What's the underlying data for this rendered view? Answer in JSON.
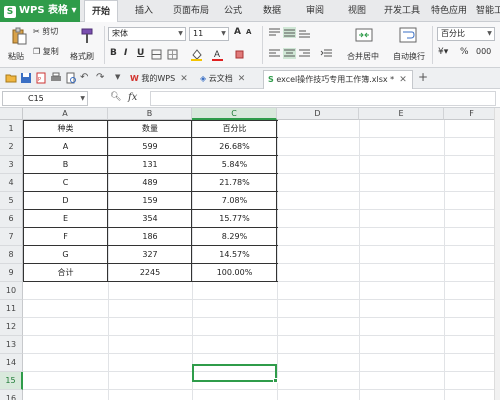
{
  "menubar": {
    "app_button": "WPS 表格",
    "tabs": [
      "开始",
      "插入",
      "页面布局",
      "公式",
      "数据",
      "审阅",
      "视图",
      "开发工具",
      "特色应用",
      "智能工"
    ],
    "active_tab": "开始"
  },
  "ribbon": {
    "cut": "剪切",
    "paste": "粘贴",
    "copy": "复制",
    "format_painter": "格式刷",
    "font_name": "宋体",
    "font_size": "11",
    "bold": "B",
    "italic": "I",
    "underline": "U",
    "merge_center": "合并居中",
    "wrap_text": "自动换行",
    "number_format": "百分比",
    "grow_font": "A",
    "shrink_font": "A"
  },
  "doc_tabs": {
    "tabs": [
      {
        "label": "我的WPS",
        "closable": true
      },
      {
        "label": "云文档",
        "closable": true
      },
      {
        "label": "excel操作技巧专用工作簿.xlsx *",
        "closable": true,
        "active": true
      }
    ],
    "add": "+"
  },
  "formula_bar": {
    "name_box": "C15",
    "fx": "fx",
    "formula": ""
  },
  "grid": {
    "columns": [
      "A",
      "B",
      "C",
      "D",
      "E",
      "F"
    ],
    "selected_column": "C",
    "rows": [
      "1",
      "2",
      "3",
      "4",
      "5",
      "6",
      "7",
      "8",
      "9",
      "10",
      "11",
      "12",
      "13",
      "14",
      "15",
      "16"
    ],
    "selected_row": "15",
    "selected_cell": "C15",
    "table": {
      "headers": [
        "种类",
        "数量",
        "百分比"
      ],
      "rows": [
        [
          "A",
          "599",
          "26.68%"
        ],
        [
          "B",
          "131",
          "5.84%"
        ],
        [
          "C",
          "489",
          "21.78%"
        ],
        [
          "D",
          "159",
          "7.08%"
        ],
        [
          "E",
          "354",
          "15.77%"
        ],
        [
          "F",
          "186",
          "8.29%"
        ],
        [
          "G",
          "327",
          "14.57%"
        ],
        [
          "合计",
          "2245",
          "100.00%"
        ]
      ]
    }
  },
  "colors": {
    "accent": "#2f9c4a",
    "table_border": "#333333"
  }
}
